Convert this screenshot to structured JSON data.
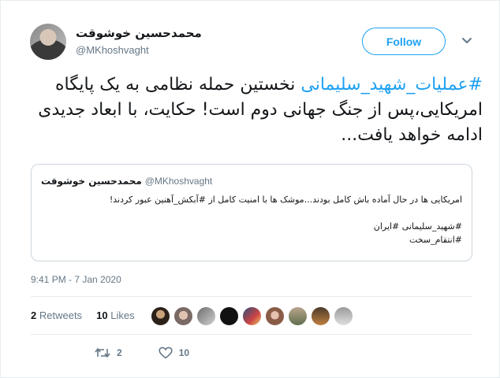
{
  "author": {
    "name": "محمدحسین خوشوقت",
    "handle": "@MKhoshvaght"
  },
  "follow_label": "Follow",
  "tweet": {
    "hashtag": "#عملیات_شهید_سلیمانی",
    "text": " نخستین حمله نظامی به یک پایگاه امریکایی،پس از جنگ جهانی دوم است! حکایت، با ابعاد جدیدی ادامه خواهد یافت..."
  },
  "quoted": {
    "name": "محمدحسین خوشوقت",
    "handle": "@MKhoshvaght",
    "lines": [
      "امریکایی ها در حال آماده باش کامل بودند...موشک ها با امنیت کامل از #آبکش_آهنین عبور کردند!",
      "#شهید_سلیمانی #ایران",
      "#انتقام_سخت"
    ]
  },
  "timestamp": "9:41 PM - 7 Jan 2020",
  "stats": {
    "retweets_count": "2",
    "retweets_label": "Retweets",
    "likes_count": "10",
    "likes_label": "Likes"
  },
  "actions": {
    "retweet_count": "2",
    "like_count": "10"
  },
  "colors": {
    "accent": "#1da1f2",
    "muted": "#657786"
  }
}
